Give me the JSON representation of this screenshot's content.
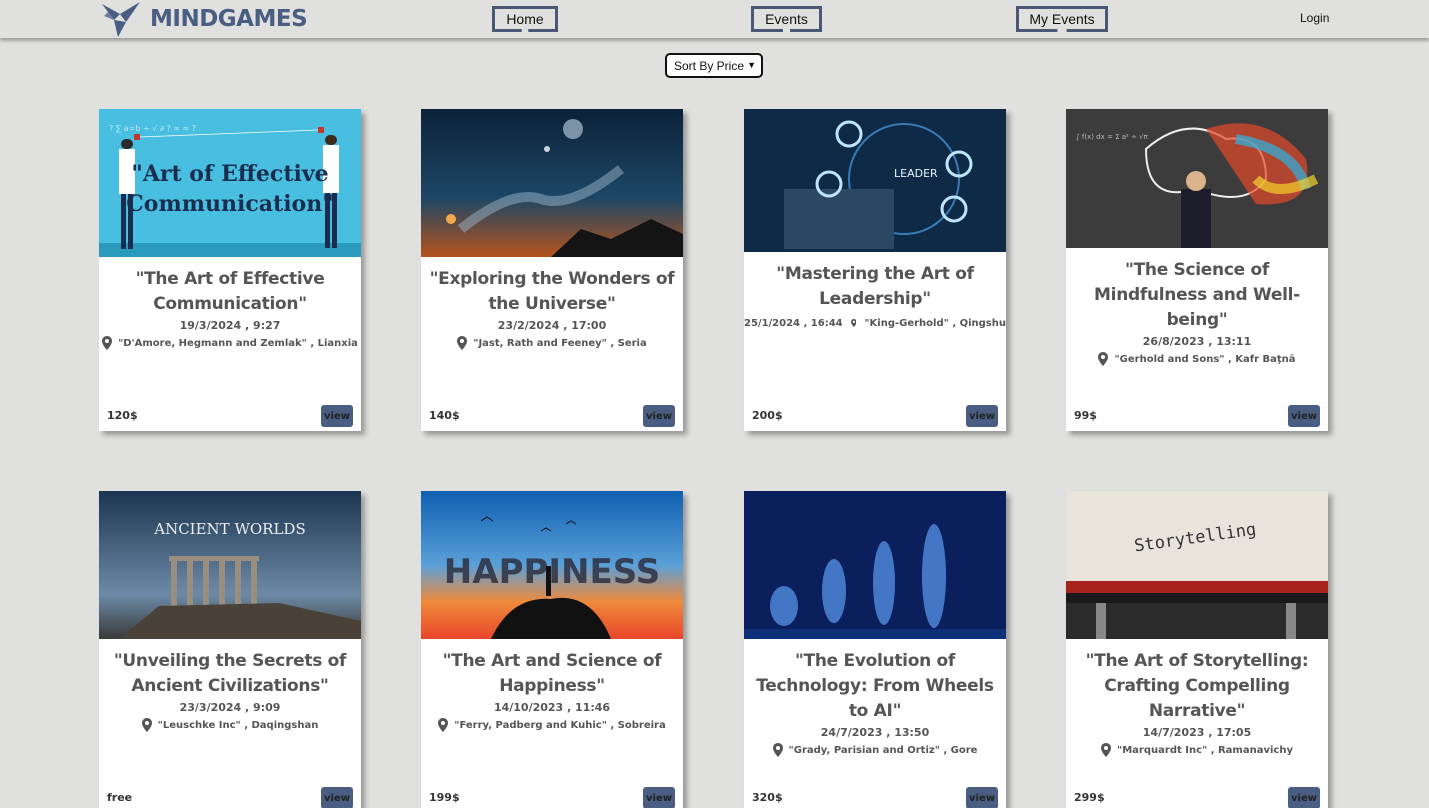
{
  "brand": {
    "name": "MINDGAMES",
    "color": "#4a5d82"
  },
  "nav": {
    "home": "Home",
    "events": "Events",
    "my_events": "My Events",
    "login": "Login"
  },
  "sort": {
    "selected": "Sort By Price"
  },
  "events": [
    {
      "title": "\"The Art of Effective Communication\"",
      "date": "19/3/2024 , 9:27",
      "location": "\"D'Amore, Hegmann and Zemlak\" , Lianxia",
      "price": "120$",
      "view": "view",
      "image_text": "\"Art of Effective Communication\""
    },
    {
      "title": "\"Exploring the Wonders of the Universe\"",
      "date": "23/2/2024 , 17:00",
      "location": "\"Jast, Rath and Feeney\" , Seria",
      "price": "140$",
      "view": "view"
    },
    {
      "title": "\"Mastering the Art of Leadership\"",
      "date": "25/1/2024 , 16:44",
      "location": "\"King-Gerhold\" , Qingshu",
      "price": "200$",
      "view": "view",
      "image_text": "LEADER"
    },
    {
      "title": "\"The Science of Mindfulness and Well-being\"",
      "date": "26/8/2023 , 13:11",
      "location": "\"Gerhold and Sons\" , Kafr Baţnā",
      "price": "99$",
      "view": "view"
    },
    {
      "title": "\"Unveiling the Secrets of Ancient Civilizations\"",
      "date": "23/3/2024 , 9:09",
      "location": "\"Leuschke Inc\" , Daqingshan",
      "price": "free",
      "view": "view",
      "image_text": "ANCIENT WORLDS"
    },
    {
      "title": "\"The Art and Science of Happiness\"",
      "date": "14/10/2023 , 11:46",
      "location": "\"Ferry, Padberg and Kuhic\" , Sobreira",
      "price": "199$",
      "view": "view",
      "image_text": "HAPPINESS"
    },
    {
      "title": "\"The Evolution of Technology: From Wheels to AI\"",
      "date": "24/7/2023 , 13:50",
      "location": "\"Grady, Parisian and Ortiz\" , Gore",
      "price": "320$",
      "view": "view"
    },
    {
      "title": "\"The Art of Storytelling: Crafting Compelling Narrative\"",
      "date": "14/7/2023 , 17:05",
      "location": "\"Marquardt Inc\" , Ramanavichy",
      "price": "299$",
      "view": "view",
      "image_text": "Storytelling"
    }
  ]
}
